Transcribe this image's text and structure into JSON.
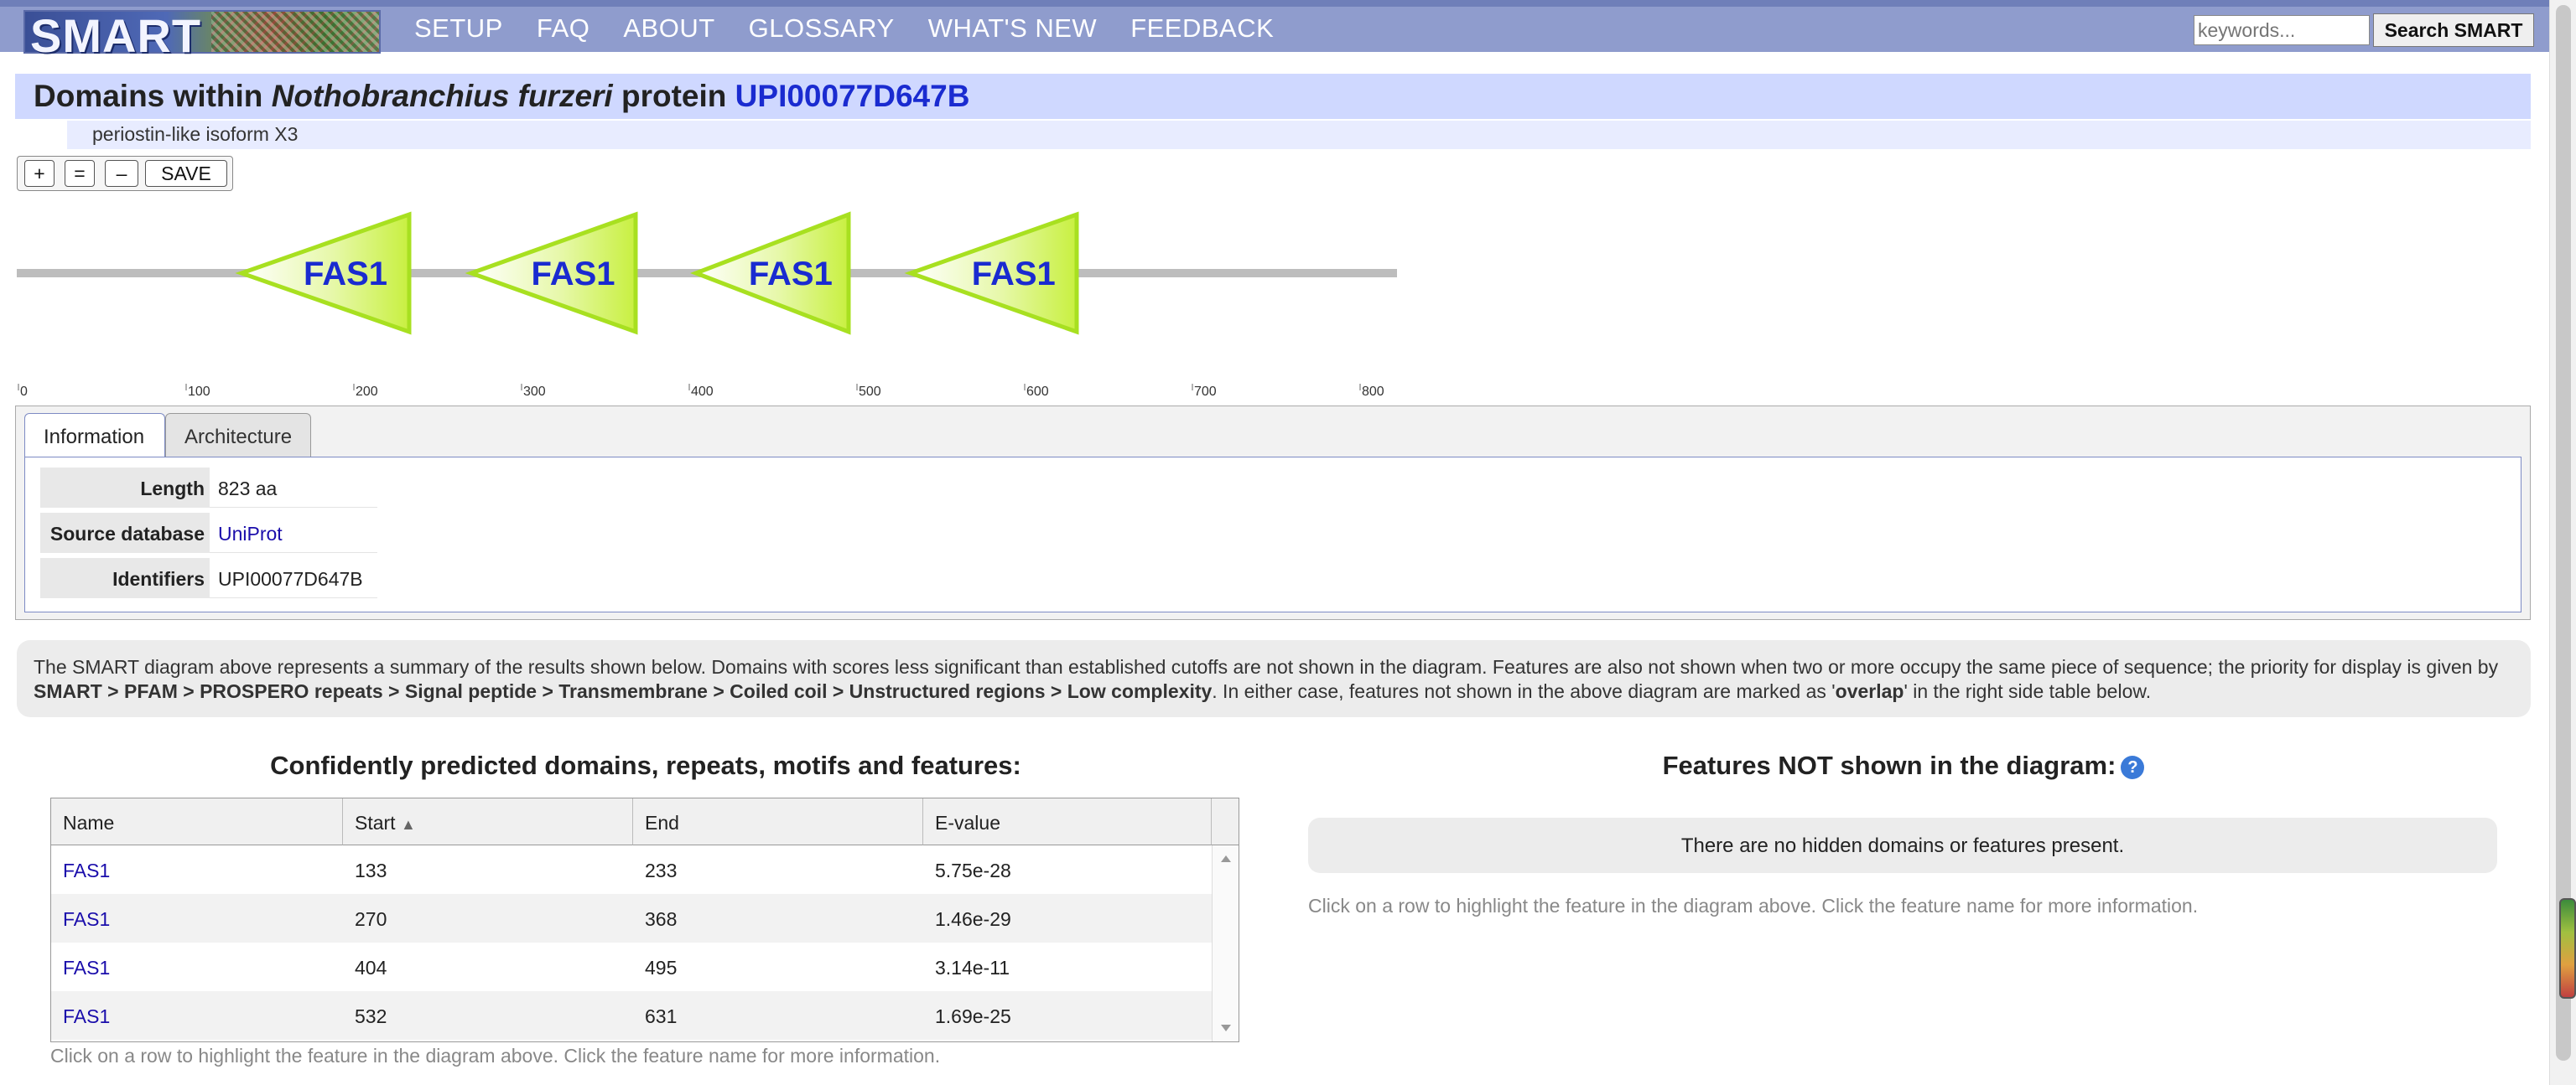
{
  "nav": {
    "logo_text": "SMART",
    "items": [
      "SETUP",
      "FAQ",
      "ABOUT",
      "GLOSSARY",
      "WHAT'S NEW",
      "FEEDBACK"
    ],
    "search_placeholder": "keywords...",
    "search_button": "Search SMART"
  },
  "header": {
    "title_prefix": "Domains within",
    "species": "Nothobranchius furzeri",
    "title_mid": "protein",
    "accession": "UPI00077D647B",
    "subtitle": "periostin-like isoform X3"
  },
  "zoom": {
    "plus": "+",
    "equal": "=",
    "minus": "–",
    "save": "SAVE"
  },
  "diagram": {
    "protein_length": 823,
    "domains": [
      {
        "label": "FAS1",
        "start": 133,
        "end": 233
      },
      {
        "label": "FAS1",
        "start": 270,
        "end": 368
      },
      {
        "label": "FAS1",
        "start": 404,
        "end": 495
      },
      {
        "label": "FAS1",
        "start": 532,
        "end": 631
      }
    ],
    "ruler_ticks": [
      "0",
      "100",
      "200",
      "300",
      "400",
      "500",
      "600",
      "700",
      "800"
    ],
    "domain_fill": "#c8f040",
    "domain_text_color": "#1a2bd0"
  },
  "info": {
    "tabs": [
      "Information",
      "Architecture"
    ],
    "rows": [
      {
        "label": "Length",
        "value": "823 aa"
      },
      {
        "label": "Source database",
        "value": "UniProt"
      },
      {
        "label": "Identifiers",
        "value": "UPI00077D647B"
      }
    ]
  },
  "note": {
    "text1": "The SMART diagram above represents a summary of the results shown below. Domains with scores less significant than established cutoffs are not shown in the diagram. Features are also not shown when two or more occupy the same piece of sequence; the priority for display is given by ",
    "priority": "SMART > PFAM > PROSPERO repeats > Signal peptide > Transmembrane > Coiled coil > Unstructured regions > Low complexity",
    "text2": ". In either case, features not shown in the above diagram are marked as '",
    "overlap": "overlap",
    "text3": "' in the right side table below."
  },
  "left_panel": {
    "title": "Confidently predicted domains, repeats, motifs and features:",
    "columns": [
      "Name",
      "Start",
      "End",
      "E-value"
    ],
    "sort_indicator": "▲",
    "rows": [
      {
        "name": "FAS1",
        "start": "133",
        "end": "233",
        "evalue": "5.75e-28"
      },
      {
        "name": "FAS1",
        "start": "270",
        "end": "368",
        "evalue": "1.46e-29"
      },
      {
        "name": "FAS1",
        "start": "404",
        "end": "495",
        "evalue": "3.14e-11"
      },
      {
        "name": "FAS1",
        "start": "532",
        "end": "631",
        "evalue": "1.69e-25"
      }
    ],
    "footnote": "Click on a row to highlight the feature in the diagram above. Click the feature name for more information."
  },
  "right_panel": {
    "title": "Features NOT shown in the diagram:",
    "help": "?",
    "empty_message": "There are no hidden domains or features present.",
    "footnote": "Click on a row to highlight the feature in the diagram above. Click the feature name for more information."
  }
}
